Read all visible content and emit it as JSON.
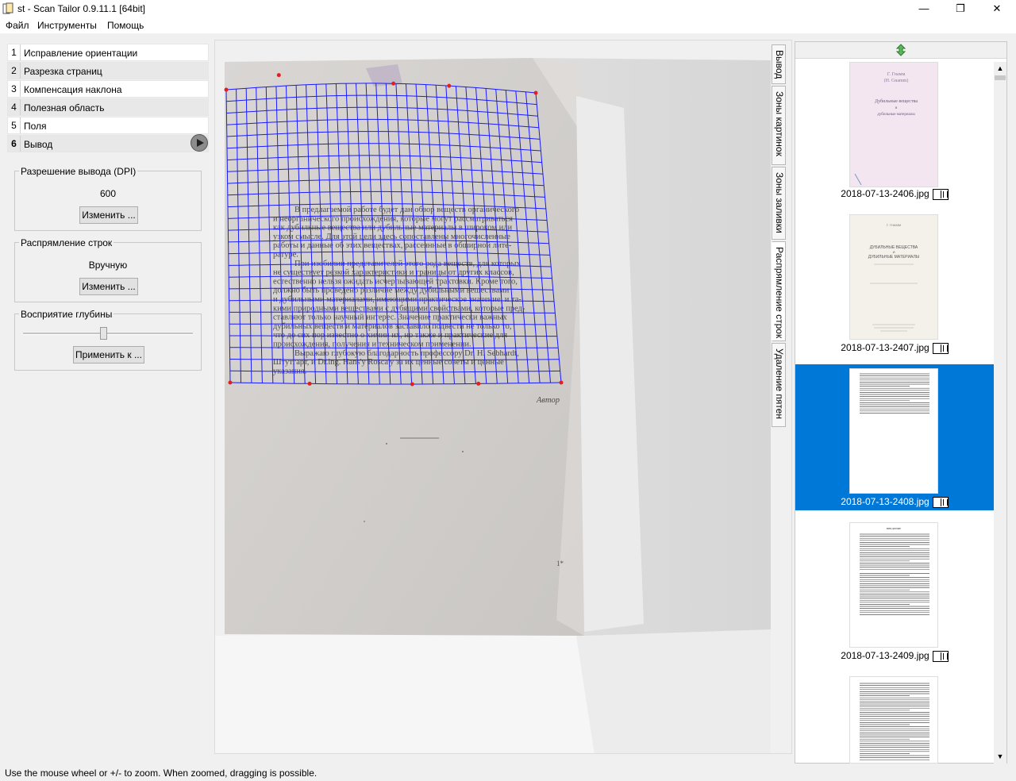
{
  "window": {
    "title": "st - Scan Tailor 0.9.11.1 [64bit]",
    "minimize_glyph": "—",
    "maximize_glyph": "❐",
    "close_glyph": "✕"
  },
  "menu": {
    "items": [
      "Файл",
      "Инструменты",
      "Помощь"
    ]
  },
  "steps": [
    {
      "num": "1",
      "label": "Исправление ориентации"
    },
    {
      "num": "2",
      "label": "Разрезка страниц"
    },
    {
      "num": "3",
      "label": "Компенсация наклона"
    },
    {
      "num": "4",
      "label": "Полезная область"
    },
    {
      "num": "5",
      "label": "Поля"
    },
    {
      "num": "6",
      "label": "Вывод"
    }
  ],
  "options": {
    "dpi": {
      "title": "Разрешение вывода (DPI)",
      "value": "600",
      "button": "Изменить ..."
    },
    "dewarp": {
      "title": "Распрямление строк",
      "value": "Вручную",
      "button": "Изменить ..."
    },
    "depth": {
      "title": "Восприятие глубины",
      "button": "Применить к ...",
      "slider_level": 0.47
    }
  },
  "tabs": [
    "Вывод",
    "Зоны картинок",
    "Зоны заливки",
    "Распрямление строк",
    "Удаление пятен"
  ],
  "active_tab": "Распрямление строк",
  "page_text": {
    "lines": [
      "В предлагаемой работе будет дан обзор веществ органического",
      "и неорганического происхождения, которые могут рассматриваться",
      "как дубильные вещества или дубильные материалы в широком или",
      "узком смысле. Для этой цели здесь сопоставлены многочисленные",
      "работы и данные об этих веществах, рассеянные в обширной лите-",
      "ратуре.",
      "При изобилии представителей этого рода веществ, для которых",
      "не существует резкой характеристики и границы от других классов,",
      "естественно нельзя ожидать исчерпывающей трактовки. Кроме того,",
      "должно быть проведено различие между дубильными веществами",
      "и дубильными материалами, имеющими практическое значение, и та-",
      "кими природными веществами с дубящими свойствами, которые пред-",
      "ставляют только научный интерес. Значение практически важных",
      "дубильных веществ и материалов заставило подвести не только то,",
      "что до сих пор известно о химии их, но также и практические для",
      "происхождения, получения и техническом применении.",
      "Выражаю глубокую благодарность профессору Dr. H. Sebhardt,",
      "Штутгарт, и Dr.ing. Hans'y Rosca'y за их ценные советы и ценные",
      "указания."
    ],
    "signature": "Автор",
    "page_mark": "1*"
  },
  "thumbnails": [
    {
      "label": "2018-07-13-2406.jpg",
      "selected": false
    },
    {
      "label": "2018-07-13-2407.jpg",
      "selected": false
    },
    {
      "label": "2018-07-13-2408.jpg",
      "selected": true
    },
    {
      "label": "2018-07-13-2409.jpg",
      "selected": false
    }
  ],
  "thumb_text": {
    "t1_author": "Г. Гнамм",
    "t1_author2": "(Н. Gnamm)",
    "t1_title1": "Дубильные вещества",
    "t1_title2": "и",
    "t1_title3": "дубильные материалы",
    "t2_author": "Г. ГНАММ",
    "t2_title1": "ДУБИЛЬНЫЕ ВЕЩЕСТВА",
    "t2_title2": "И",
    "t2_title3": "ДУБИЛЬНЫЕ МАТЕРИАЛЫ",
    "t4_heading": "ВВЕДЕНИЕ"
  },
  "colors": {
    "selection": "#0078d7",
    "grid": "#1a1aff",
    "control_point": "#e02020"
  },
  "icons": {
    "app": "scan-tailor-app-icon",
    "play": "play-icon",
    "insert": "insert-page-icon",
    "page_view": "page-view-icon"
  },
  "scrollbar": {
    "up": "▲",
    "down": "▼"
  },
  "status": "Use the mouse wheel or +/- to zoom.  When zoomed, dragging is possible."
}
